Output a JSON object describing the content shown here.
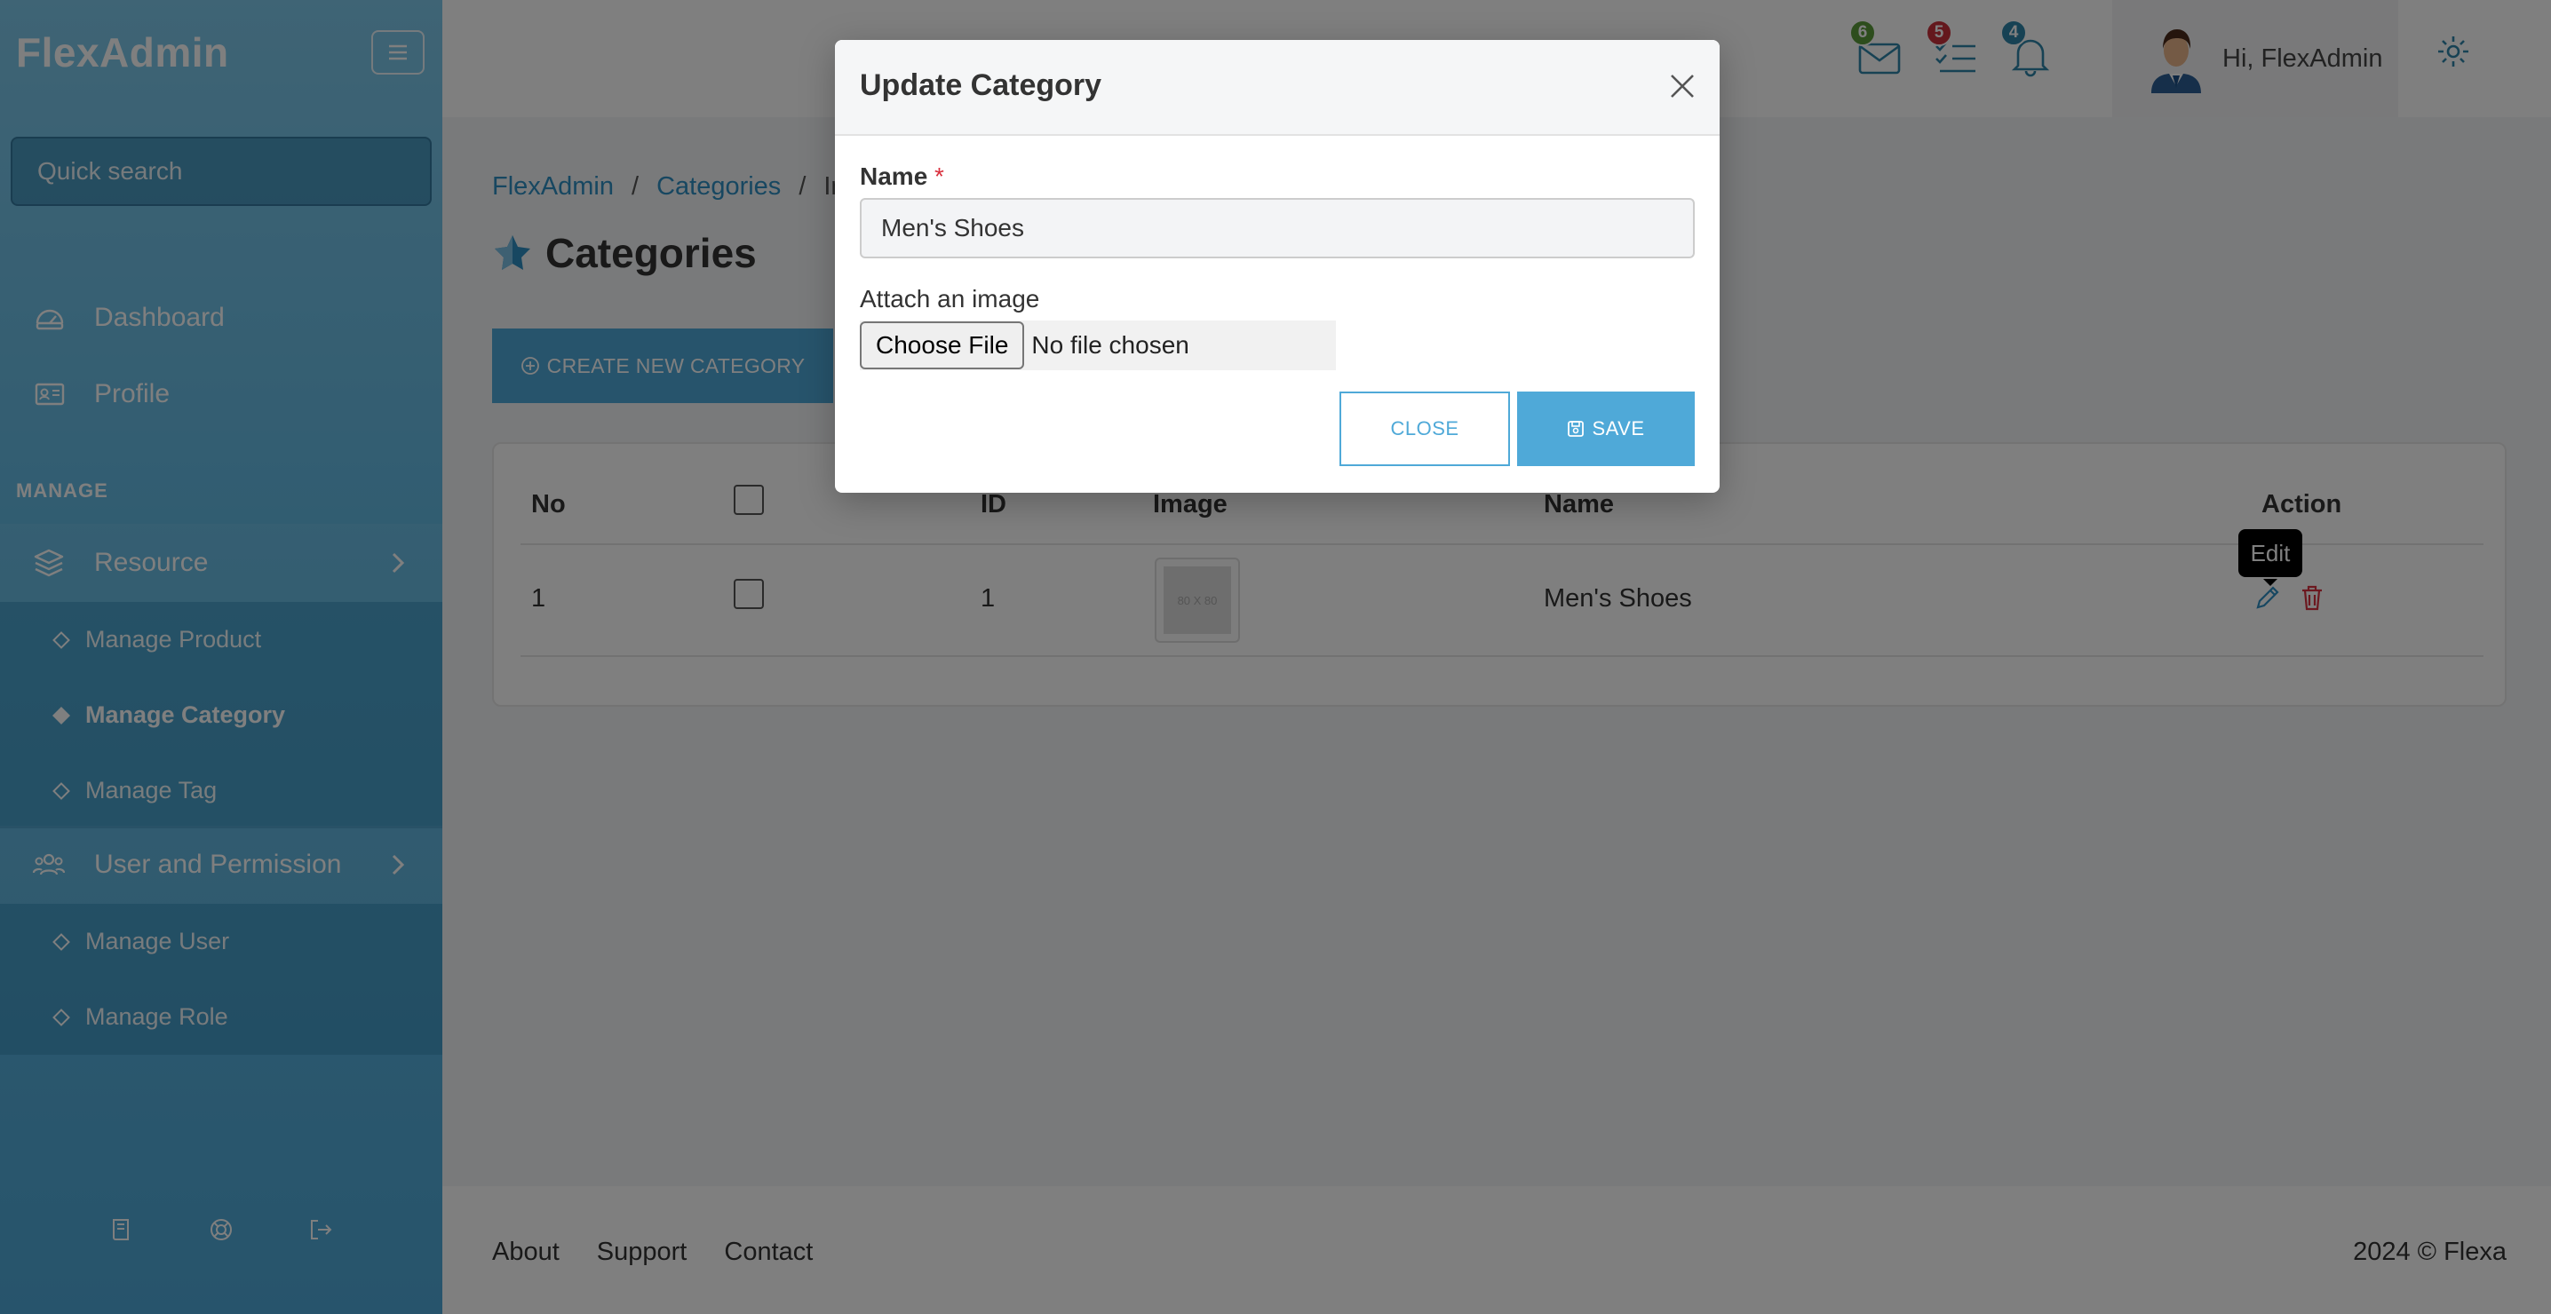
{
  "app": {
    "brand": "FlexAdmin"
  },
  "sidebar": {
    "search_placeholder": "Quick search",
    "nav": [
      {
        "label": "Dashboard",
        "icon": "dashboard-icon"
      },
      {
        "label": "Profile",
        "icon": "profile-card-icon"
      }
    ],
    "section_label": "MANAGE",
    "groups": [
      {
        "label": "Resource",
        "icon": "layers-icon",
        "items": [
          {
            "label": "Manage Product",
            "active": false
          },
          {
            "label": "Manage Category",
            "active": true
          },
          {
            "label": "Manage Tag",
            "active": false
          }
        ]
      },
      {
        "label": "User and Permission",
        "icon": "users-icon",
        "items": [
          {
            "label": "Manage User",
            "active": false
          },
          {
            "label": "Manage Role",
            "active": false
          }
        ]
      }
    ],
    "footer_icons": [
      "book-icon",
      "lifebuoy-icon",
      "logout-icon"
    ]
  },
  "header": {
    "mail_count": "6",
    "tasks_count": "5",
    "notifications_count": "4",
    "user_greeting": "Hi, FlexAdmin",
    "badge_colors": {
      "mail": "#5a9a3a",
      "tasks": "#c8303a",
      "notifications": "#2f84a8"
    }
  },
  "main": {
    "breadcrumb": [
      "FlexAdmin",
      "Categories",
      "Ind"
    ],
    "title": "Categories",
    "create_button": "CREATE NEW CATEGORY",
    "table": {
      "headers": {
        "no": "No",
        "id": "ID",
        "image": "Image",
        "name": "Name",
        "action": "Action"
      },
      "rows": [
        {
          "no": "1",
          "id": "1",
          "image_text": "80 X 80",
          "name": "Men's Shoes"
        }
      ]
    },
    "tooltip": "Edit"
  },
  "footer": {
    "links": [
      "About",
      "Support",
      "Contact"
    ],
    "copyright": "2024 © Flexa"
  },
  "modal": {
    "title": "Update Category",
    "name_label": "Name",
    "required_mark": "*",
    "name_value": "Men's Shoes",
    "image_label": "Attach an image",
    "file_button": "Choose File",
    "file_status": "No file chosen",
    "close_button": "CLOSE",
    "save_button": "SAVE"
  },
  "colors": {
    "accent": "#4fa9d8",
    "link": "#2e8fc2",
    "danger": "#d9303e"
  }
}
